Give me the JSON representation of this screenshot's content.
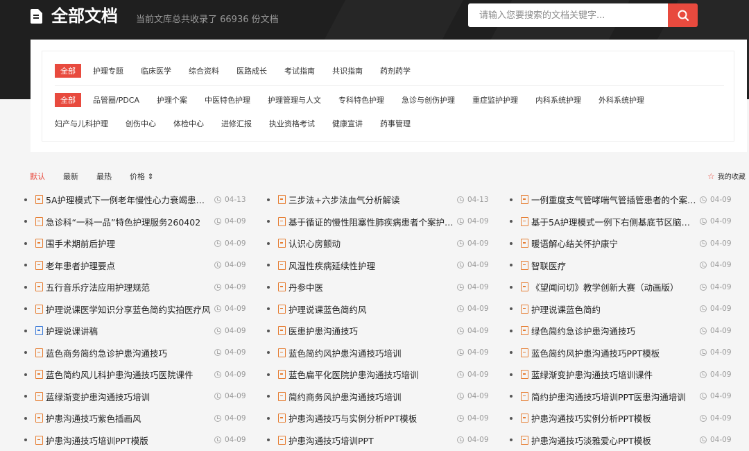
{
  "header": {
    "title": "全部文档",
    "subtitle": "当前文库总共收录了 66936 份文档",
    "search_placeholder": "请输入您要搜索的文档关键字..."
  },
  "filters": {
    "row1": [
      "全部",
      "护理专题",
      "临床医学",
      "综合资料",
      "医路成长",
      "考试指南",
      "共识指南",
      "药剂药学"
    ],
    "row2": [
      "全部",
      "品管圈/PDCA",
      "护理个案",
      "中医特色护理",
      "护理管理与人文",
      "专科特色护理",
      "急诊与创伤护理",
      "重症监护护理",
      "内科系统护理",
      "外科系统护理"
    ],
    "row3": [
      "妇产与儿科护理",
      "创伤中心",
      "体检中心",
      "进修汇报",
      "执业资格考试",
      "健康宣讲",
      "药事管理"
    ]
  },
  "sort": {
    "options": [
      "默认",
      "最新",
      "最热",
      "价格 ⇕"
    ],
    "favorites": "我的收藏"
  },
  "columns": [
    [
      {
        "title": "5A护理模式下一例老年慢性心力衰竭患者...",
        "date": "04-13",
        "type": "pdf"
      },
      {
        "title": "急诊科“一科一品”特色护理服务260402",
        "date": "04-09",
        "type": "pdf"
      },
      {
        "title": "围手术期前后护理",
        "date": "04-09",
        "type": "pdf"
      },
      {
        "title": "老年患者护理要点",
        "date": "04-09",
        "type": "pdf"
      },
      {
        "title": "五行音乐疗法应用护理规范",
        "date": "04-09",
        "type": "pdf"
      },
      {
        "title": "护理说课医学知识分享蓝色简约实拍医疗风",
        "date": "04-09",
        "type": "pdf"
      },
      {
        "title": "护理说课讲稿",
        "date": "04-09",
        "type": "doc"
      },
      {
        "title": "蓝色商务简约急诊护患沟通技巧",
        "date": "04-09",
        "type": "pdf"
      },
      {
        "title": "蓝色简约风儿科护患沟通技巧医院课件",
        "date": "04-09",
        "type": "pdf"
      },
      {
        "title": "蓝绿渐变护患沟通技巧培训",
        "date": "04-09",
        "type": "pdf"
      },
      {
        "title": "护患沟通技巧紫色插画风",
        "date": "04-09",
        "type": "pdf"
      },
      {
        "title": "护患沟通技巧培训PPT模版",
        "date": "04-09",
        "type": "pdf"
      }
    ],
    [
      {
        "title": "三步法+六步法血气分析解读",
        "date": "04-13",
        "type": "pdf"
      },
      {
        "title": "基于循证的慢性阻塞性肺疾病患者个案护理...",
        "date": "04-09",
        "type": "pdf"
      },
      {
        "title": "认识心房颤动",
        "date": "04-09",
        "type": "pdf"
      },
      {
        "title": "风湿性疾病延续性护理",
        "date": "04-09",
        "type": "pdf"
      },
      {
        "title": "丹参中医",
        "date": "04-09",
        "type": "pdf"
      },
      {
        "title": "护理说课蓝色简约风",
        "date": "04-09",
        "type": "pdf"
      },
      {
        "title": "医患护患沟通技巧",
        "date": "04-09",
        "type": "pdf"
      },
      {
        "title": "蓝色简约风护患沟通技巧培训",
        "date": "04-09",
        "type": "pdf"
      },
      {
        "title": "蓝色扁平化医院护患沟通技巧培训",
        "date": "04-09",
        "type": "pdf"
      },
      {
        "title": "简约商务风护患沟通技巧培训",
        "date": "04-09",
        "type": "pdf"
      },
      {
        "title": "护患沟通技巧与实例分析PPT模板",
        "date": "04-09",
        "type": "pdf"
      },
      {
        "title": "护患沟通技巧培训PPT",
        "date": "04-09",
        "type": "pdf"
      }
    ],
    [
      {
        "title": "一例重度支气管哮喘气管插管患者的个案护...",
        "date": "04-09",
        "type": "pdf"
      },
      {
        "title": "基于5A护理模式一例下右侧基底节区脑出...",
        "date": "04-09",
        "type": "pdf"
      },
      {
        "title": "暖语解心结关怀护康宁",
        "date": "04-09",
        "type": "pdf"
      },
      {
        "title": "智联医疗",
        "date": "04-09",
        "type": "pdf"
      },
      {
        "title": "《望闻问切》教学创新大赛（动画版）",
        "date": "04-09",
        "type": "pdf"
      },
      {
        "title": "护理说课蓝色简约",
        "date": "04-09",
        "type": "pdf"
      },
      {
        "title": "绿色简约急诊护患沟通技巧",
        "date": "04-09",
        "type": "pdf"
      },
      {
        "title": "蓝色简约风护患沟通技巧PPT模板",
        "date": "04-09",
        "type": "pdf"
      },
      {
        "title": "蓝绿渐变护患沟通技巧培训课件",
        "date": "04-09",
        "type": "pdf"
      },
      {
        "title": "简约护患沟通技巧培训PPT医患沟通培训",
        "date": "04-09",
        "type": "pdf"
      },
      {
        "title": "护患沟通技巧实例分析PPT模板",
        "date": "04-09",
        "type": "pdf"
      },
      {
        "title": "护患沟通技巧淡雅爱心PPT模板",
        "date": "04-09",
        "type": "pdf"
      }
    ]
  ],
  "colors": {
    "accent": "#e84a3e",
    "pdf_icon": "#e67e33",
    "doc_icon": "#3d7bd8"
  }
}
